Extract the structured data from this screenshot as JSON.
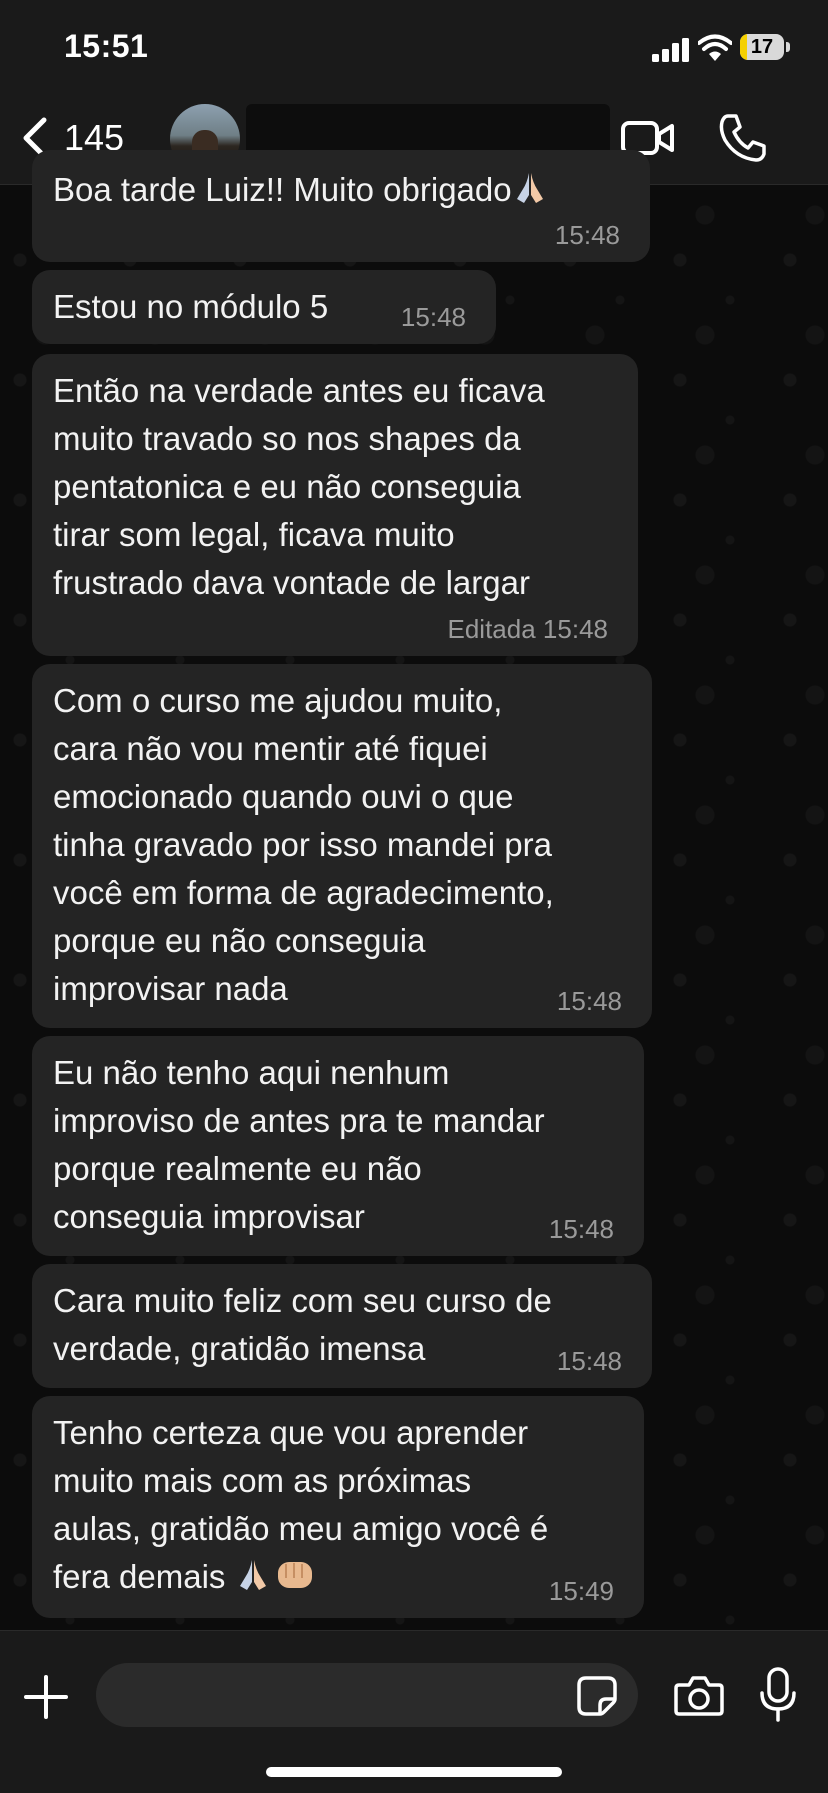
{
  "status_bar": {
    "time": "15:51",
    "battery_level": "17",
    "battery_fraction": 0.17
  },
  "header": {
    "back_count": "145",
    "icons": {
      "back": "chevron-left-icon",
      "video": "video-camera-icon",
      "call": "phone-icon"
    }
  },
  "messages": [
    {
      "text_lines": [
        "Boa tarde Luiz!! Muito obrigado"
      ],
      "emoji": "🙏🏻",
      "edited_label": "",
      "time": "15:48"
    },
    {
      "text_lines": [
        "Estou no módulo 5"
      ],
      "edited_label": "",
      "time": "15:48"
    },
    {
      "text_lines": [
        "Então na verdade antes eu ficava",
        "muito travado so nos shapes da",
        "pentatonica e eu não conseguia",
        "tirar som legal, ficava muito",
        "frustrado dava vontade de largar"
      ],
      "edited_label": "Editada",
      "time": "15:48"
    },
    {
      "text_lines": [
        "Com o curso me ajudou muito,",
        "cara não vou mentir até fiquei",
        "emocionado quando ouvi o que",
        "tinha gravado por isso mandei pra",
        "você em forma de agradecimento,",
        "porque eu não conseguia",
        "improvisar nada"
      ],
      "edited_label": "",
      "time": "15:48"
    },
    {
      "text_lines": [
        "Eu não tenho aqui nenhum",
        "improviso de antes pra te mandar",
        "porque realmente eu não",
        "conseguia improvisar"
      ],
      "edited_label": "",
      "time": "15:48"
    },
    {
      "text_lines": [
        "Cara muito feliz com seu curso de",
        "verdade,  gratidão imensa"
      ],
      "edited_label": "",
      "time": "15:48"
    },
    {
      "text_lines": [
        "Tenho certeza que vou aprender",
        "muito mais com as próximas",
        "aulas, gratidão meu amigo você é",
        "fera demais"
      ],
      "emoji": "🙏🏻👊🏼",
      "edited_label": "",
      "time": "15:49"
    }
  ],
  "composer": {
    "placeholder": "",
    "icons": {
      "attach": "plus-icon",
      "sticker": "sticker-icon",
      "camera": "camera-icon",
      "mic": "microphone-icon"
    }
  }
}
